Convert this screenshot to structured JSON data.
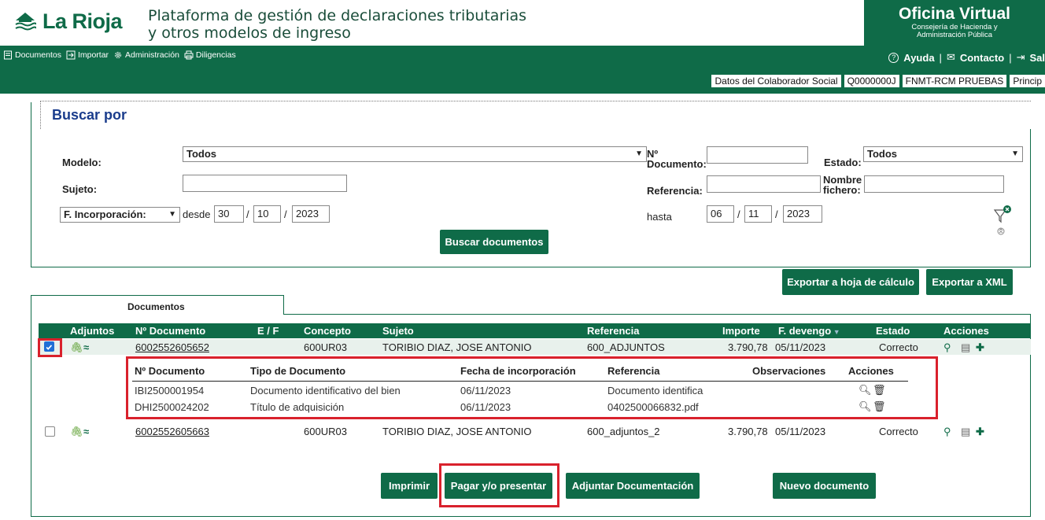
{
  "header": {
    "brand": "La Rioja",
    "platform_title_line1": "Plataforma de gestión de declaraciones tributarias",
    "platform_title_line2": "y otros modelos de ingreso",
    "ov_title": "Oficina Virtual",
    "ov_sub1": "Consejería de Hacienda y",
    "ov_sub2": "Administración Pública"
  },
  "nav": {
    "documentos": "Documentos",
    "importar": "Importar",
    "administracion": "Administración",
    "diligencias": "Diligencias",
    "ayuda": "Ayuda",
    "contacto": "Contacto",
    "salir": "Sal"
  },
  "status": {
    "colaborador": "Datos del Colaborador Social",
    "nif": "Q0000000J",
    "cert": "FNMT-RCM PRUEBAS",
    "principal": "Princip"
  },
  "search": {
    "title": "Buscar por",
    "modelo_label": "Modelo:",
    "modelo_value": "Todos",
    "sujeto_label": "Sujeto:",
    "sujeto_value": "",
    "fecha_tipo": "F. Incorporación:",
    "desde_label": "desde",
    "desde_d": "30",
    "desde_m": "10",
    "desde_y": "2023",
    "n_documento_label_1": "Nº",
    "n_documento_label_2": "Documento:",
    "n_documento_value": "",
    "referencia_label": "Referencia:",
    "referencia_value": "",
    "hasta_label": "hasta",
    "hasta_d": "06",
    "hasta_m": "11",
    "hasta_y": "2023",
    "estado_label": "Estado:",
    "estado_value": "Todos",
    "nombre_fichero_1": "Nombre",
    "nombre_fichero_2": "fichero:",
    "nombre_fichero_value": "",
    "buscar_button": "Buscar documentos",
    "slash": "/"
  },
  "actions_top": {
    "export_xls": "Exportar a hoja de cálculo",
    "export_xml": "Exportar a XML"
  },
  "results": {
    "tab_label": "Documentos",
    "headers": {
      "adjuntos": "Adjuntos",
      "n_documento": "Nº Documento",
      "ef": "E / F",
      "concepto": "Concepto",
      "sujeto": "Sujeto",
      "referencia": "Referencia",
      "importe": "Importe",
      "f_devengo": "F. devengo",
      "estado": "Estado",
      "acciones": "Acciones"
    },
    "rows": [
      {
        "checked": true,
        "n_documento": "6002552605652",
        "concepto": "600UR03",
        "sujeto": "TORIBIO DIAZ, JOSE ANTONIO",
        "referencia": "600_ADJUNTOS",
        "importe": "3.790,78",
        "f_devengo": "05/11/2023",
        "estado": "Correcto"
      },
      {
        "checked": false,
        "n_documento": "6002552605663",
        "concepto": "600UR03",
        "sujeto": "TORIBIO DIAZ, JOSE ANTONIO",
        "referencia": "600_adjuntos_2",
        "importe": "3.790,78",
        "f_devengo": "05/11/2023",
        "estado": "Correcto"
      }
    ],
    "attachments": {
      "headers": {
        "n_documento": "Nº Documento",
        "tipo": "Tipo de Documento",
        "fecha": "Fecha de incorporación",
        "referencia": "Referencia",
        "observaciones": "Observaciones",
        "acciones": "Acciones"
      },
      "rows": [
        {
          "n_documento": "IBI2500001954",
          "tipo": "Documento identificativo del bien",
          "fecha": "06/11/2023",
          "referencia": "Documento identifica"
        },
        {
          "n_documento": "DHI2500024202",
          "tipo": "Título de adquisición",
          "fecha": "06/11/2023",
          "referencia": "0402500066832.pdf"
        }
      ]
    }
  },
  "bottom_buttons": {
    "imprimir": "Imprimir",
    "pagar": "Pagar y/o presentar",
    "adjuntar": "Adjuntar Documentación",
    "nuevo": "Nuevo documento"
  },
  "colors": {
    "brand_green": "#0f6b48",
    "highlight_red": "#d9212c",
    "title_blue": "#1a3c8c"
  }
}
